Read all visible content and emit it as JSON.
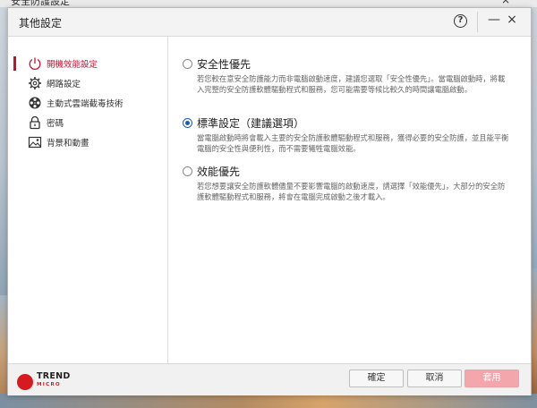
{
  "background_window": {
    "title": "安全防護設定",
    "close_glyph": "×"
  },
  "dialog": {
    "title": "其他設定",
    "help_glyph": "?",
    "minimize_glyph": "—",
    "close_glyph": "×"
  },
  "sidebar": {
    "items": [
      {
        "label": "開機效能設定",
        "icon": "power-icon",
        "active": true
      },
      {
        "label": "網路設定",
        "icon": "gear-icon",
        "active": false
      },
      {
        "label": "主動式雲端截毒技術",
        "icon": "film-reel-icon",
        "active": false
      },
      {
        "label": "密碼",
        "icon": "lock-icon",
        "active": false
      },
      {
        "label": "背景和動畫",
        "icon": "image-icon",
        "active": false
      }
    ]
  },
  "options": [
    {
      "title": "安全性優先",
      "selected": false,
      "description": "若您較在意安全防護能力而非電腦啟動速度，建議您選取「安全性優先」。當電腦啟動時，將載入完整的安全防護軟體驅動程式和服務，您可能需要等候比較久的時間讓電腦啟動。"
    },
    {
      "title": "標準設定（建議選項）",
      "selected": true,
      "description": "當電腦啟動時將會載入主要的安全防護軟體驅動程式和服務，獲得必要的安全防護，並且能平衡電腦的安全性與便利性，而不需要犧牲電腦效能。"
    },
    {
      "title": "效能優先",
      "selected": false,
      "description": "若您想要讓安全防護軟體儘量不要影響電腦的啟動速度，請選擇「效能優先」，大部分的安全防護軟體驅動程式和服務，將會在電腦完成啟動之後才載入。"
    }
  ],
  "footer": {
    "logo_text": "TREND",
    "logo_sub": "MICRO",
    "confirm_label": "確定",
    "cancel_label": "取消",
    "apply_label": "套用"
  },
  "colors": {
    "accent": "#c8102e",
    "radio_selected": "#1a5fb4",
    "apply_disabled": "#f3a6ab"
  }
}
